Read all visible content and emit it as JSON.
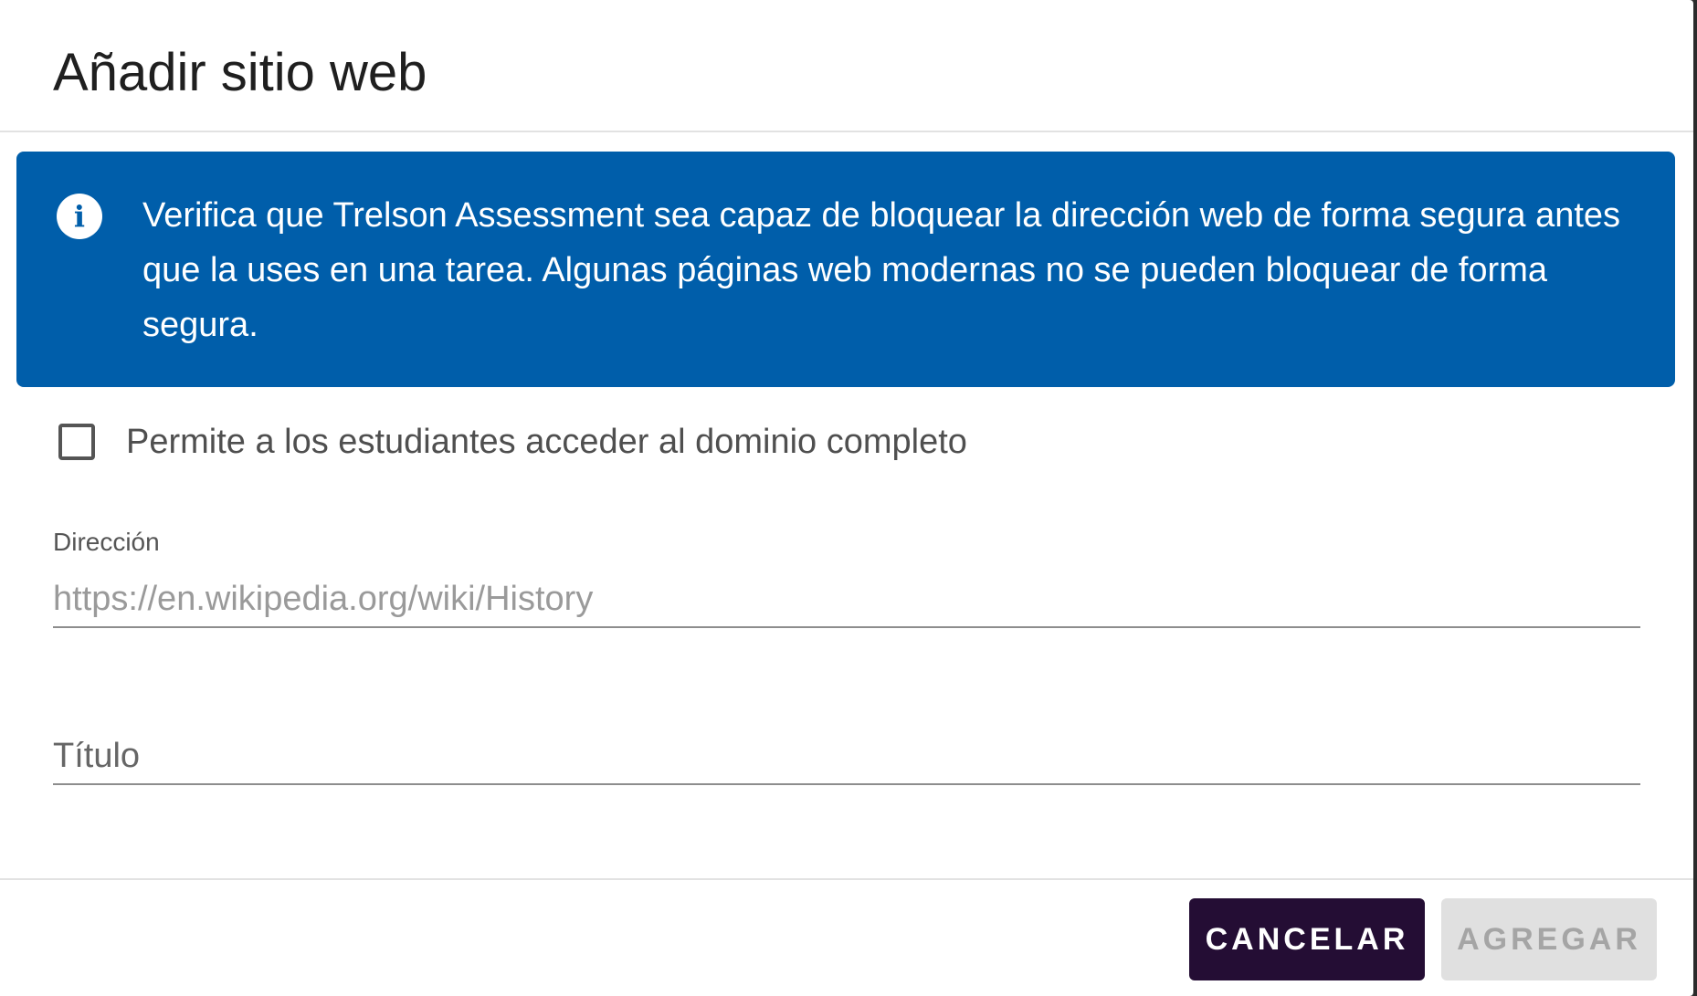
{
  "dialog": {
    "title": "Añadir sitio web"
  },
  "info_banner": {
    "icon": "info-icon",
    "icon_glyph": "i",
    "text": "Verifica que Trelson Assessment sea capaz de bloquear la dirección web de forma segura antes que la uses en una tarea. Algunas páginas web modernas no se pueden bloquear de forma segura.",
    "background_color": "#005eaa"
  },
  "domain_checkbox": {
    "label": "Permite a los estudiantes acceder al dominio completo",
    "checked": false
  },
  "address_field": {
    "label": "Dirección",
    "value": "",
    "placeholder": "https://en.wikipedia.org/wiki/History"
  },
  "title_field": {
    "value": "",
    "placeholder": "Título"
  },
  "footer": {
    "cancel_label": "CANCELAR",
    "add_label": "AGREGAR",
    "cancel_color": "#240d34",
    "add_disabled": true
  }
}
